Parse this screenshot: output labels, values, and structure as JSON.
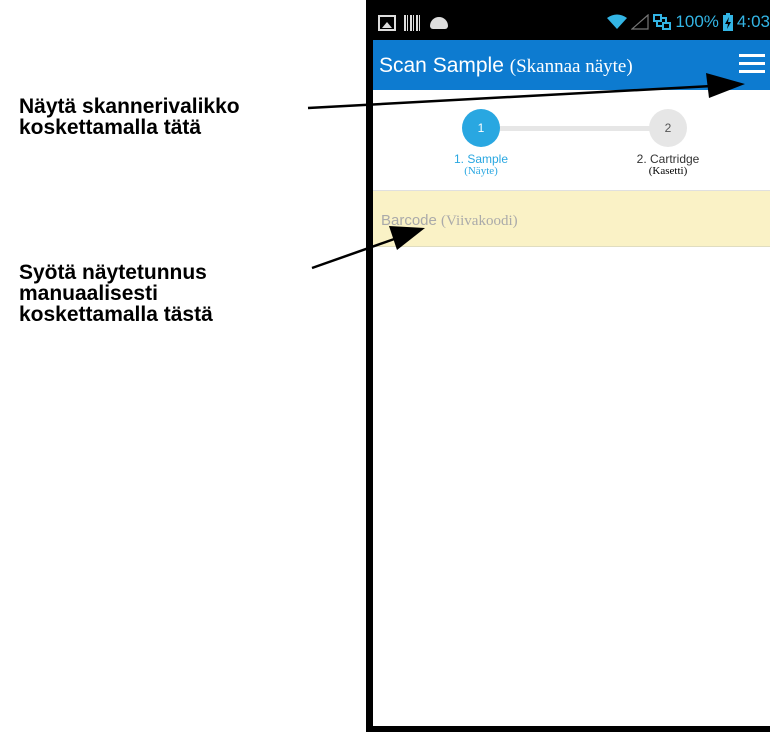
{
  "callouts": {
    "menu": [
      "Näytä skannerivalikko",
      "koskettamalla tätä"
    ],
    "barcode": [
      "Syötä näytetunnus",
      "manuaalisesti",
      "koskettamalla tästä"
    ]
  },
  "statusbar": {
    "battery": "100%",
    "time": "4:03",
    "icons": [
      "picture-icon",
      "barcode-icon",
      "android-icon",
      "wifi-icon",
      "signal-icon",
      "network-icon",
      "battery-charging-icon"
    ]
  },
  "appbar": {
    "title": "Scan Sample",
    "title_translation": "(Skannaa näyte)",
    "menu_icon": "hamburger-menu-icon",
    "color": "#0d7bd0"
  },
  "stepper": {
    "steps": [
      {
        "number": "1",
        "label": "1. Sample",
        "translation": "(Näyte)",
        "active": true
      },
      {
        "number": "2",
        "label": "2. Cartridge",
        "translation": "(Kasetti)",
        "active": false
      }
    ],
    "active_color": "#29a7e1"
  },
  "barcode_field": {
    "placeholder": "Barcode",
    "placeholder_translation": "(Viivakoodi)",
    "background": "#faf2c6"
  }
}
